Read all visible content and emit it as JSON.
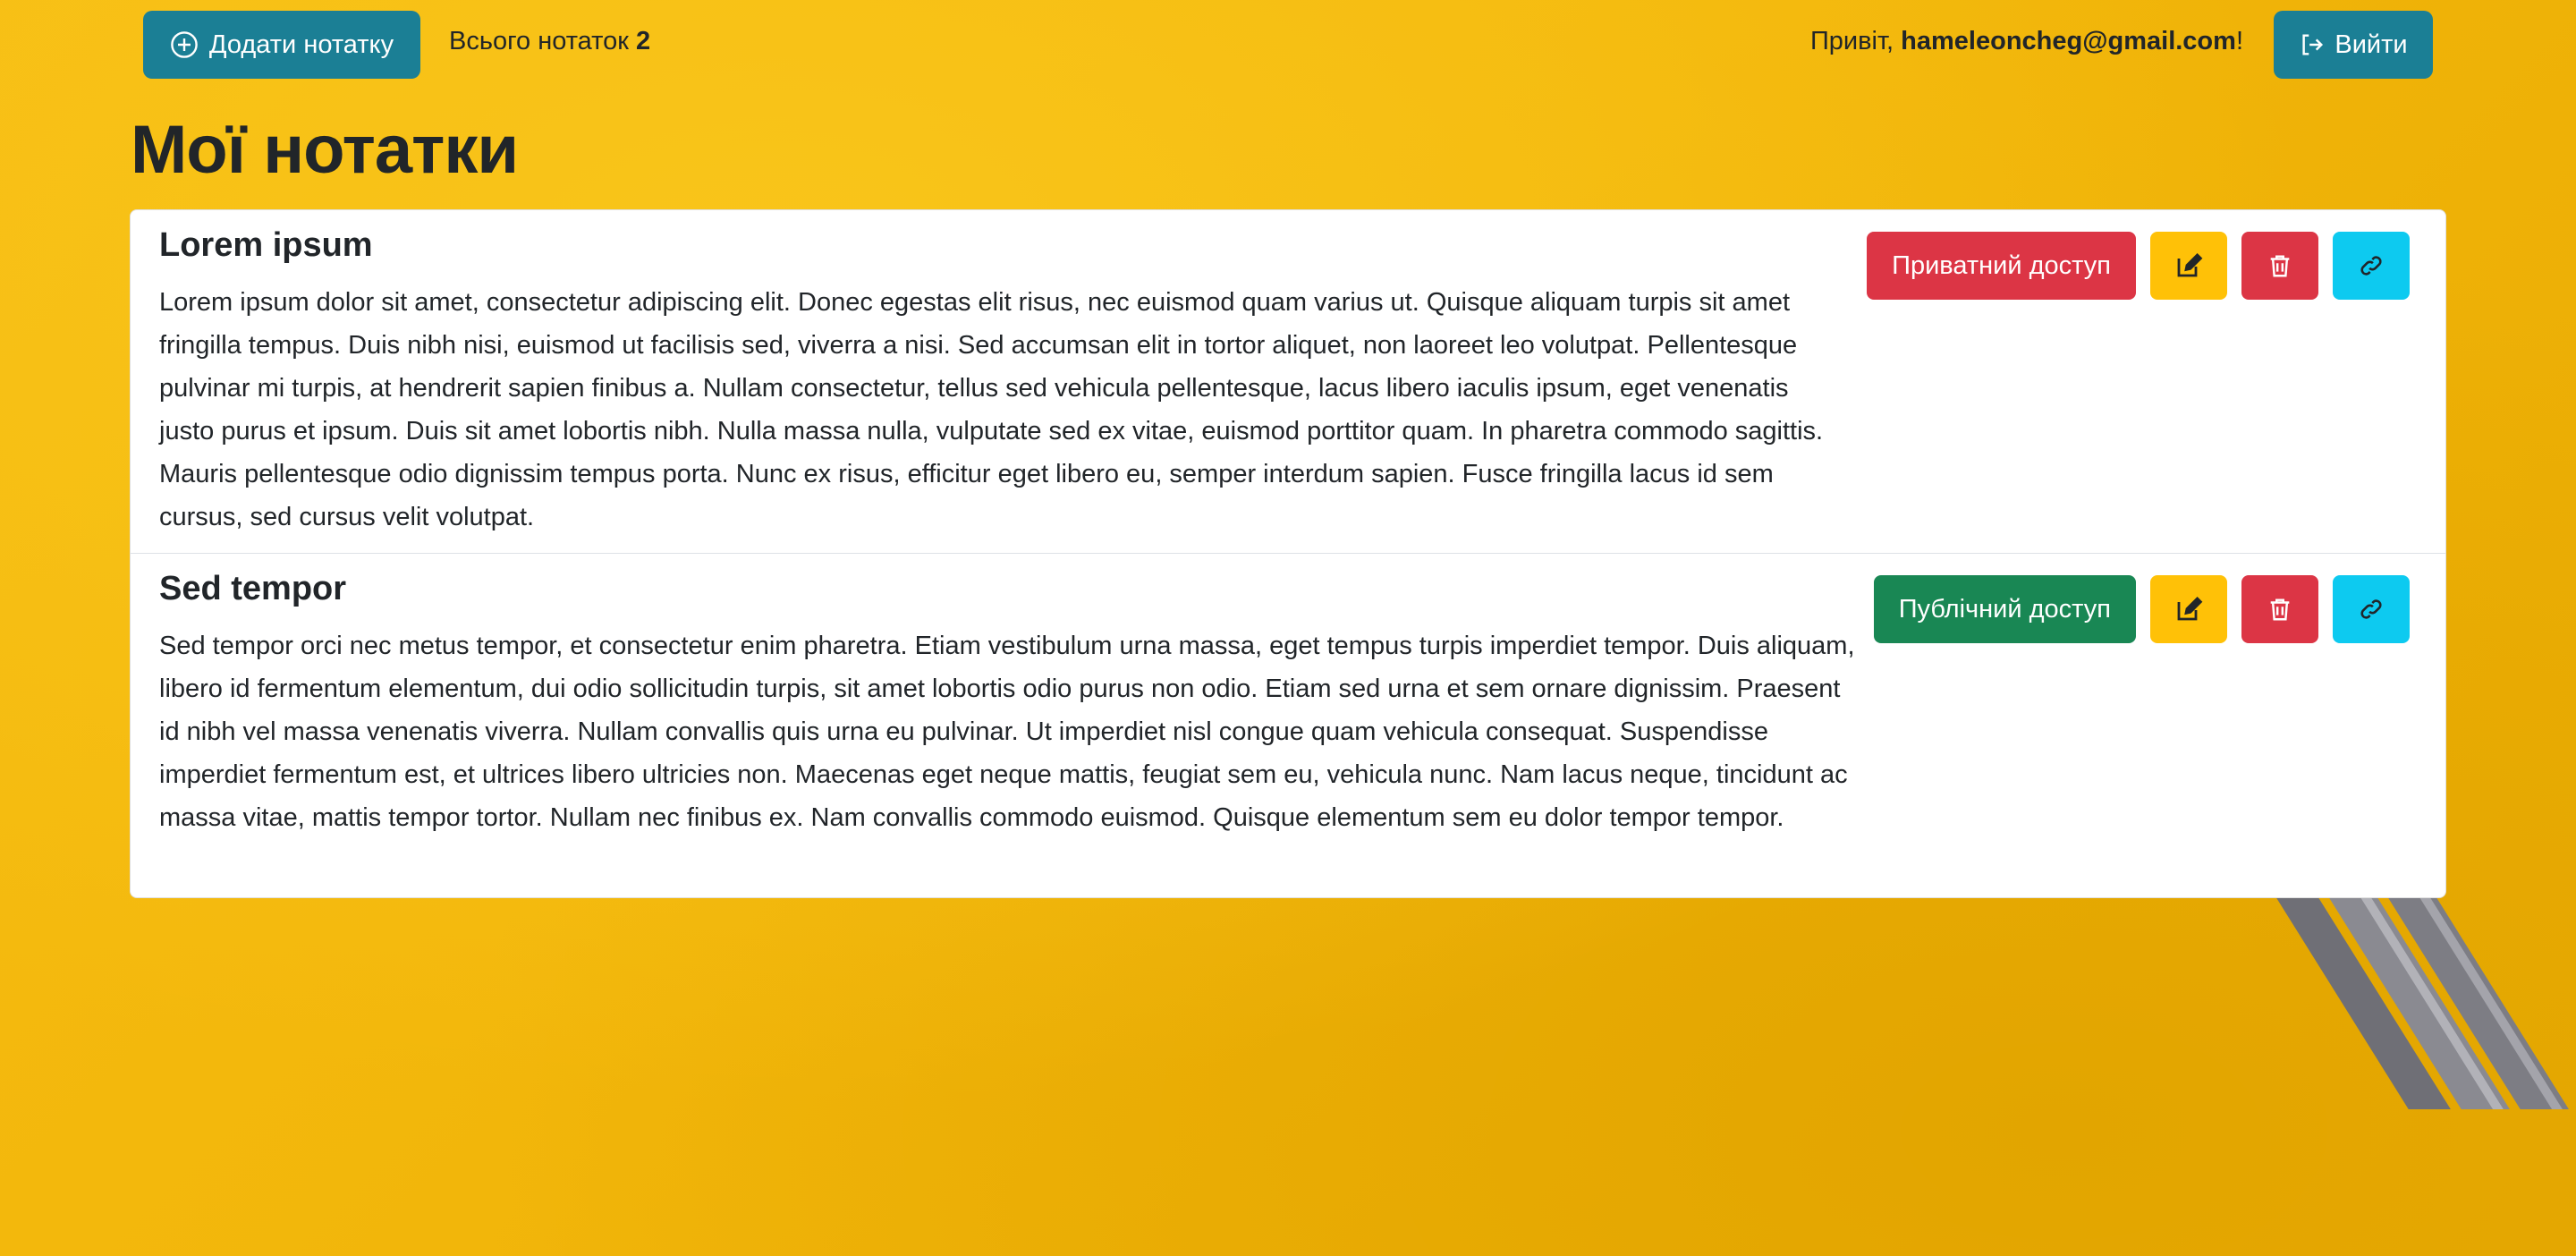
{
  "navbar": {
    "add_label": "Додати нотатку",
    "count_prefix": "Всього нотаток",
    "count_value": "2",
    "greeting_prefix": "Привіт,",
    "user_email": "hameleoncheg@gmail.com",
    "greeting_suffix": "!",
    "logout_label": "Вийти",
    "add_icon": "plus-circle-icon",
    "logout_icon": "logout-icon"
  },
  "page": {
    "title": "Мої нотатки"
  },
  "notes": [
    {
      "title": "Lorem ipsum",
      "body": "Lorem ipsum dolor sit amet, consectetur adipiscing elit. Donec egestas elit risus, nec euismod quam varius ut. Quisque aliquam turpis sit amet fringilla tempus. Duis nibh nisi, euismod ut facilisis sed, viverra a nisi. Sed accumsan elit in tortor aliquet, non laoreet leo volutpat. Pellentesque pulvinar mi turpis, at hendrerit sapien finibus a. Nullam consectetur, tellus sed vehicula pellentesque, lacus libero iaculis ipsum, eget venenatis justo purus et ipsum. Duis sit amet lobortis nibh. Nulla massa nulla, vulputate sed ex vitae, euismod porttitor quam. In pharetra commodo sagittis. Mauris pellentesque odio dignissim tempus porta. Nunc ex risus, efficitur eget libero eu, semper interdum sapien. Fusce fringilla lacus id sem cursus, sed cursus velit volutpat.",
      "access_label": "Приватний доступ",
      "access_color": "#dc3545"
    },
    {
      "title": "Sed tempor",
      "body": "Sed tempor orci nec metus tempor, et consectetur enim pharetra. Etiam vestibulum urna massa, eget tempus turpis imperdiet tempor. Duis aliquam, libero id fermentum elementum, dui odio sollicitudin turpis, sit amet lobortis odio purus non odio. Etiam sed urna et sem ornare dignissim. Praesent id nibh vel massa venenatis viverra. Nullam convallis quis urna eu pulvinar. Ut imperdiet nisl congue quam vehicula consequat. Suspendisse imperdiet fermentum est, et ultrices libero ultricies non. Maecenas eget neque mattis, feugiat sem eu, vehicula nunc. Nam lacus neque, tincidunt ac massa vitae, mattis tempor tortor. Nullam nec finibus ex. Nam convallis commodo euismod. Quisque elementum sem eu dolor tempor tempor.",
      "access_label": "Публічний доступ",
      "access_color": "#198754"
    }
  ],
  "icons": {
    "edit": "edit-icon",
    "delete": "trash-icon",
    "link": "link-icon"
  },
  "colors": {
    "primary": "#1b7f95",
    "warning": "#ffc107",
    "danger": "#dc3545",
    "success": "#198754",
    "info": "#0dcaf0",
    "background": "#f6bd12"
  }
}
